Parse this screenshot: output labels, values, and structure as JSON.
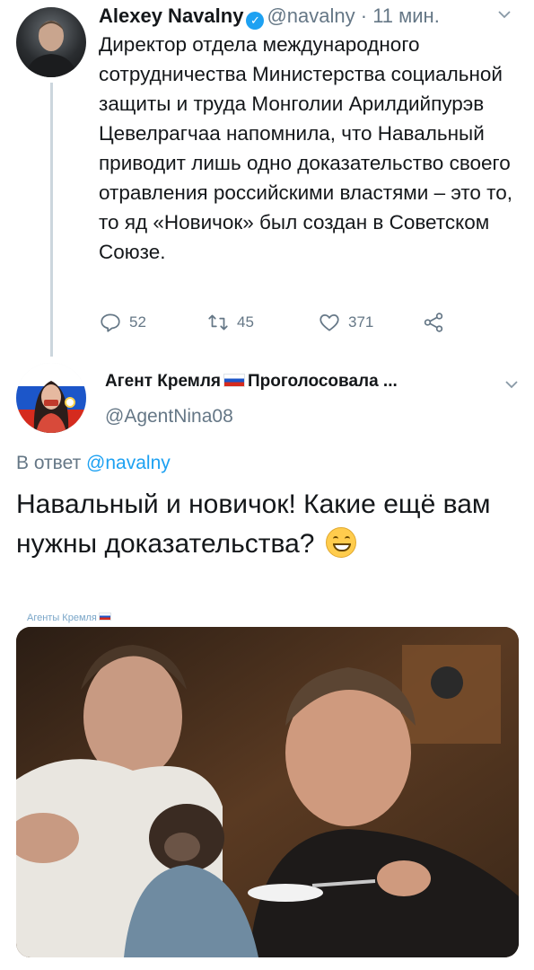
{
  "tweet1": {
    "author_name": "Alexey Navalny",
    "handle": "@navalny",
    "dot": "·",
    "time": "11 мин.",
    "text": "Директор отдела международного сотрудничества Министерства социальной защиты и труда Монголии Арилдийпурэв Цевелрагчаа напомнила, что Навальный приводит лишь одно доказательство своего отравления российскими властями – это то, то яд «Новичок» был создан в Советском Союзе.",
    "actions": {
      "replies": "52",
      "retweets": "45",
      "likes": "371"
    }
  },
  "tweet2": {
    "author_name_part1": "Агент Кремля",
    "author_name_part2": "Проголосовала ...",
    "handle": "@AgentNina08",
    "reply_prefix": "В ответ",
    "reply_mention": "@navalny",
    "text": "Навальный и новичок! Какие ещё вам нужны доказательства?",
    "image_watermark": "Агенты Кремля"
  },
  "colors": {
    "text": "#14171a",
    "secondary": "#657786",
    "accent": "#1da1f2",
    "thread_line": "#ccd6dd"
  },
  "icons": [
    "verified-badge-icon",
    "chevron-down-icon",
    "reply-icon",
    "retweet-icon",
    "like-icon",
    "share-icon",
    "russian-flag-icon",
    "grinning-face-emoji"
  ]
}
